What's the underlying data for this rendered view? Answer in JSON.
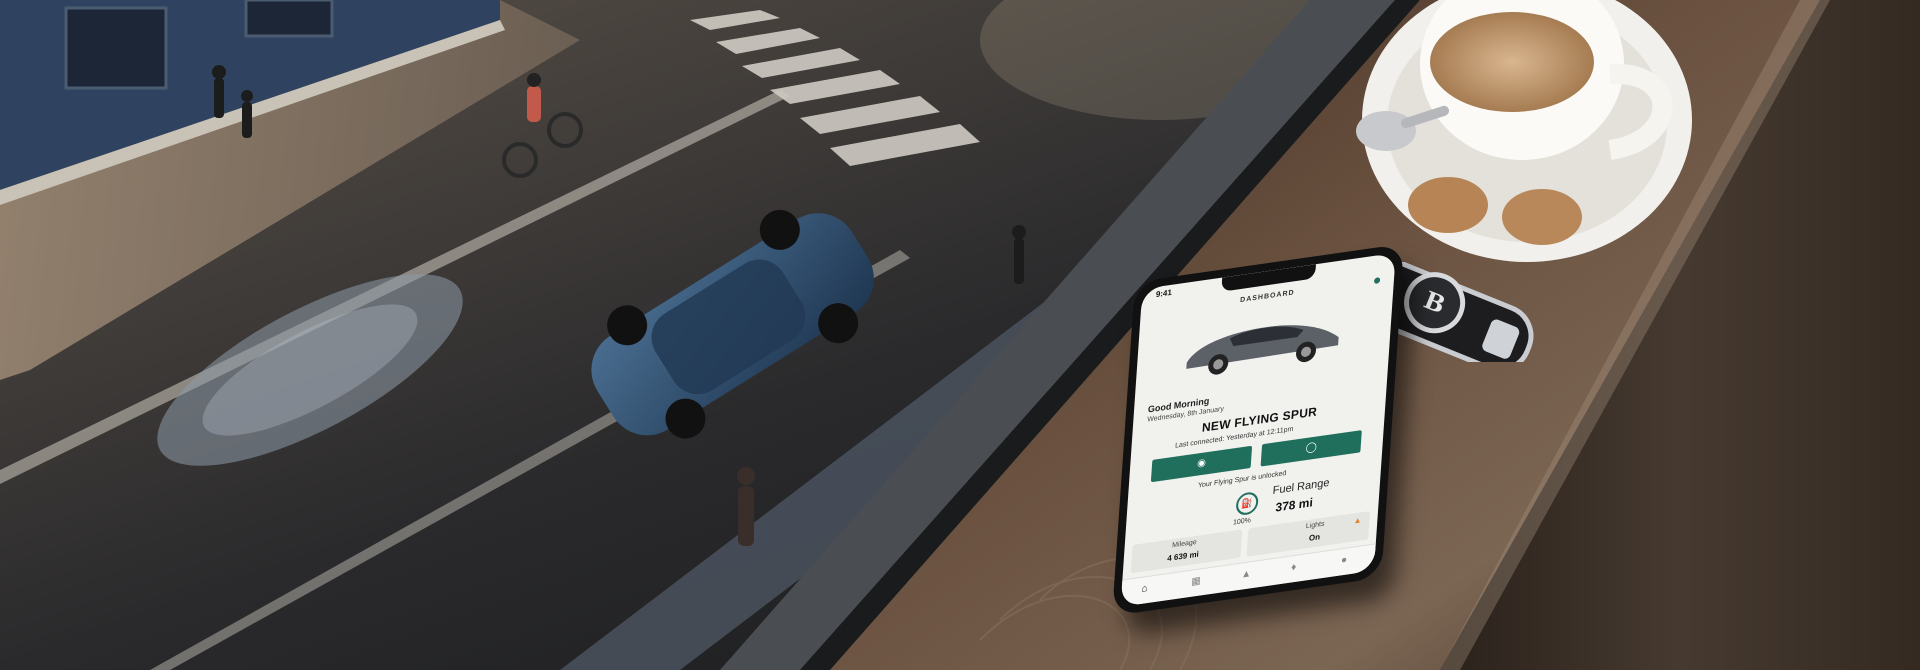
{
  "app": {
    "status_time": "9:41",
    "screen_title": "DASHBOARD",
    "greeting": "Good Morning",
    "date": "Wednesday, 8th January",
    "model_name": "NEW FLYING SPUR",
    "last_connected": "Last connected: Yesterday at 12:11pm",
    "lock_icon": "lock-icon",
    "unlock_icon": "unlock-icon",
    "unlock_status": "Your Flying Spur is unlocked",
    "fuel": {
      "label": "Fuel Range",
      "value": "378 mi",
      "percent_text": "100%",
      "icon": "fuel-pump-icon"
    },
    "tiles": {
      "mileage_label": "Mileage",
      "mileage_value": "4 639 mi",
      "lights_label": "Lights",
      "lights_value": "On"
    },
    "tabs": [
      "home-icon",
      "grid-icon",
      "navigate-icon",
      "bell-icon",
      "profile-icon"
    ]
  },
  "colors": {
    "accent_green": "#1f6f5c",
    "warning": "#e3822a"
  }
}
